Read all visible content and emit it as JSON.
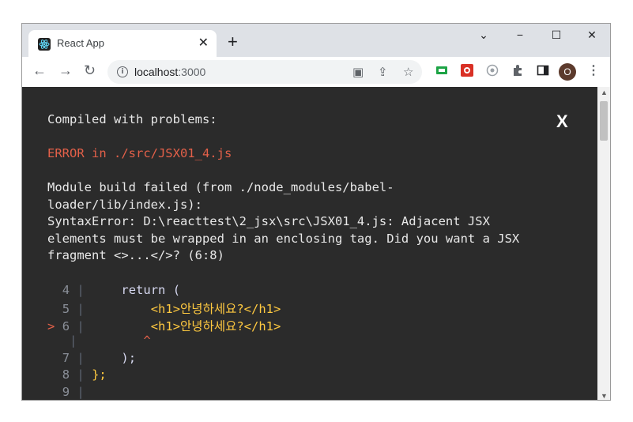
{
  "tab": {
    "title": "React App",
    "close": "✕",
    "new_tab": "+"
  },
  "window_controls": {
    "minimize": "−",
    "maximize": "☐",
    "close": "✕",
    "tab_search": "⌄"
  },
  "toolbar": {
    "back": "←",
    "forward": "→",
    "reload": "↻",
    "menu": "⋮"
  },
  "address": {
    "host": "localhost",
    "port": ":3000"
  },
  "profile": {
    "initial": "O"
  },
  "overlay": {
    "title": "Compiled with problems:",
    "close": "X",
    "error_header": "ERROR in ./src/JSX01_4.js",
    "message_lines": [
      "Module build failed (from ./node_modules/babel-",
      "loader/lib/index.js):",
      "SyntaxError: D:\\reacttest\\2_jsx\\src\\JSX01_4.js: Adjacent JSX",
      "elements must be wrapped in an enclosing tag. Did you want a JSX",
      "fragment <>...</>? (6:8)"
    ],
    "code": [
      {
        "marker": " ",
        "num": "4",
        "text": "    return ("
      },
      {
        "marker": " ",
        "num": "5",
        "text": "        <h1>안녕하세요?</h1>"
      },
      {
        "marker": ">",
        "num": "6",
        "text": "        <h1>안녕하세요?</h1>"
      },
      {
        "marker": " ",
        "num": "",
        "text": "        ^"
      },
      {
        "marker": " ",
        "num": "7",
        "text": "    );"
      },
      {
        "marker": " ",
        "num": "8",
        "text": "};"
      },
      {
        "marker": " ",
        "num": "9",
        "text": ""
      }
    ]
  },
  "colors": {
    "overlay_bg": "#2b2b2b",
    "error": "#e36049",
    "jsx_tag": "#ffc940",
    "profile": "#5c3a2c"
  }
}
